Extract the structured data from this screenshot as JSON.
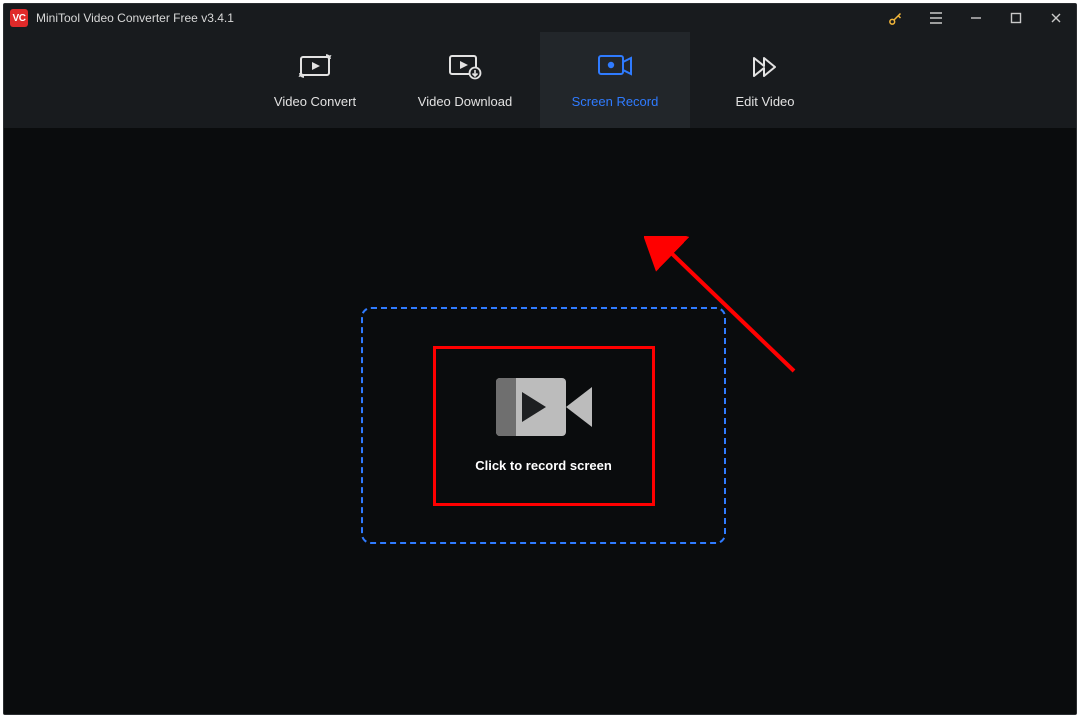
{
  "window": {
    "title": "MiniTool Video Converter Free v3.4.1"
  },
  "tabs": [
    {
      "label": "Video Convert"
    },
    {
      "label": "Video Download"
    },
    {
      "label": "Screen Record"
    },
    {
      "label": "Edit Video"
    }
  ],
  "activeTabIndex": 2,
  "main": {
    "record_button_label": "Click to record screen"
  }
}
